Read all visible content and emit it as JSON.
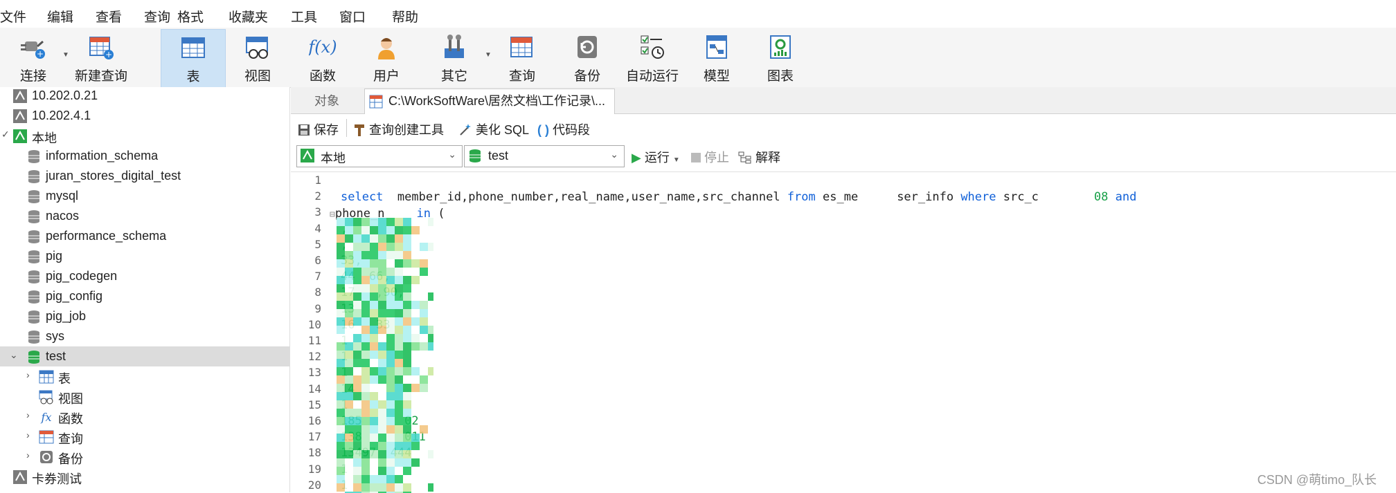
{
  "menu": [
    "文件",
    "编辑",
    "查看",
    "查询",
    "格式",
    "收藏夹",
    "工具",
    "窗口",
    "帮助"
  ],
  "toolbar": {
    "connect": "连接",
    "new_query": "新建查询",
    "table": "表",
    "view": "视图",
    "function": "函数",
    "user": "用户",
    "other": "其它",
    "query": "查询",
    "backup": "备份",
    "autorun": "自动运行",
    "model": "模型",
    "chart": "图表"
  },
  "sidebar": {
    "items": [
      {
        "label": "10.202.0.21",
        "type": "connection"
      },
      {
        "label": "10.202.4.1",
        "type": "connection"
      },
      {
        "label": "本地",
        "type": "connection",
        "expanded": true
      },
      {
        "label": "information_schema",
        "type": "database"
      },
      {
        "label": "juran_stores_digital_test",
        "type": "database"
      },
      {
        "label": "mysql",
        "type": "database"
      },
      {
        "label": "nacos",
        "type": "database"
      },
      {
        "label": "performance_schema",
        "type": "database"
      },
      {
        "label": "pig",
        "type": "database"
      },
      {
        "label": "pig_codegen",
        "type": "database"
      },
      {
        "label": "pig_config",
        "type": "database"
      },
      {
        "label": "pig_job",
        "type": "database"
      },
      {
        "label": "sys",
        "type": "database"
      },
      {
        "label": "test",
        "type": "database",
        "selected": true,
        "expanded": true
      },
      {
        "label": "表",
        "type": "tables"
      },
      {
        "label": "视图",
        "type": "views"
      },
      {
        "label": "函数",
        "type": "functions"
      },
      {
        "label": "查询",
        "type": "queries"
      },
      {
        "label": "备份",
        "type": "backups"
      },
      {
        "label": "卡券测试",
        "type": "connection"
      }
    ]
  },
  "tabs": {
    "objects": "对象",
    "file": "C:\\WorkSoftWare\\居然文档\\工作记录\\..."
  },
  "editor_toolbar": {
    "save": "保存",
    "query_builder": "查询创建工具",
    "beautify": "美化 SQL",
    "snippet": "代码段"
  },
  "run_bar": {
    "connection": "本地",
    "database": "test",
    "run": "运行",
    "stop": "停止",
    "explain": "解释"
  },
  "code": {
    "line_numbers": [
      "1",
      "2",
      "3",
      "4",
      "5",
      "6",
      "7",
      "8",
      "9",
      "10",
      "11",
      "12",
      "13",
      "14",
      "15",
      "16",
      "17",
      "18",
      "19",
      "20"
    ],
    "line2_select": "select",
    "line2_cols": "  member_id,phone_number,real_name,user_name,src_channel ",
    "line2_from": "from",
    "line2_table": " es_me",
    "line2_table2": "ser_info ",
    "line2_where": "where",
    "line2_cond": " src_c",
    "line2_val": "08",
    "line2_and": "and",
    "line3_col": "phone_n",
    "line3_in": "in",
    "line3_paren": " (",
    "rows_visible": [
      "",
      "",
      "",
      ",",
      ",",
      "33,",
      "44  66,",
      "17   ,90,",
      "13",
      "16   33",
      "1",
      "1",
      "1",
      "14",
      "1",
      "185      02",
      "138      011",
      "13497  444",
      "1",
      "1"
    ]
  },
  "watermark": "CSDN @萌timo_队长"
}
